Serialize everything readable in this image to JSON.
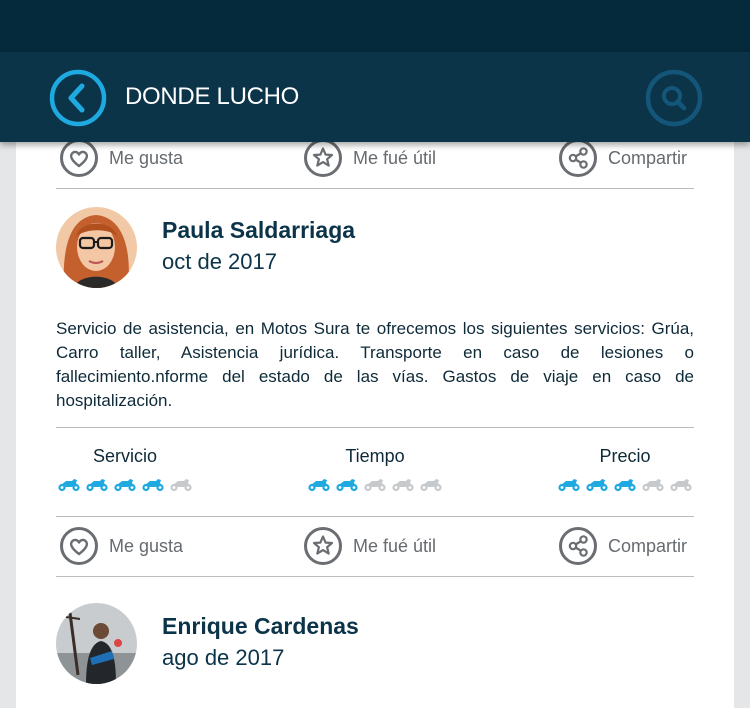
{
  "header": {
    "title": "DONDE LUCHO",
    "back_icon": "chevron-left-icon",
    "search_icon": "search-icon"
  },
  "colors": {
    "header_bg": "#0b3449",
    "accent": "#1fa9e1",
    "muted": "#c6cacc"
  },
  "actions": {
    "like_label": "Me gusta",
    "useful_label": "Me fué útil",
    "share_label": "Compartir"
  },
  "reviews": [
    {
      "author": "Paula Saldarriaga",
      "date": "oct de 2017",
      "text": "Servicio de asistencia, en Motos Sura te ofrecemos los siguientes servicios: Grúa, Carro taller, Asistencia jurídica. Transporte en caso de lesiones o fallecimiento.nforme del estado de las vías. Gastos de viaje en caso de hospitalización.",
      "ratings": [
        {
          "label": "Servicio",
          "value": 4,
          "max": 5
        },
        {
          "label": "Tiempo",
          "value": 2,
          "max": 5
        },
        {
          "label": "Precio",
          "value": 3,
          "max": 5
        }
      ]
    },
    {
      "author": "Enrique Cardenas",
      "date": "ago de 2017"
    }
  ]
}
